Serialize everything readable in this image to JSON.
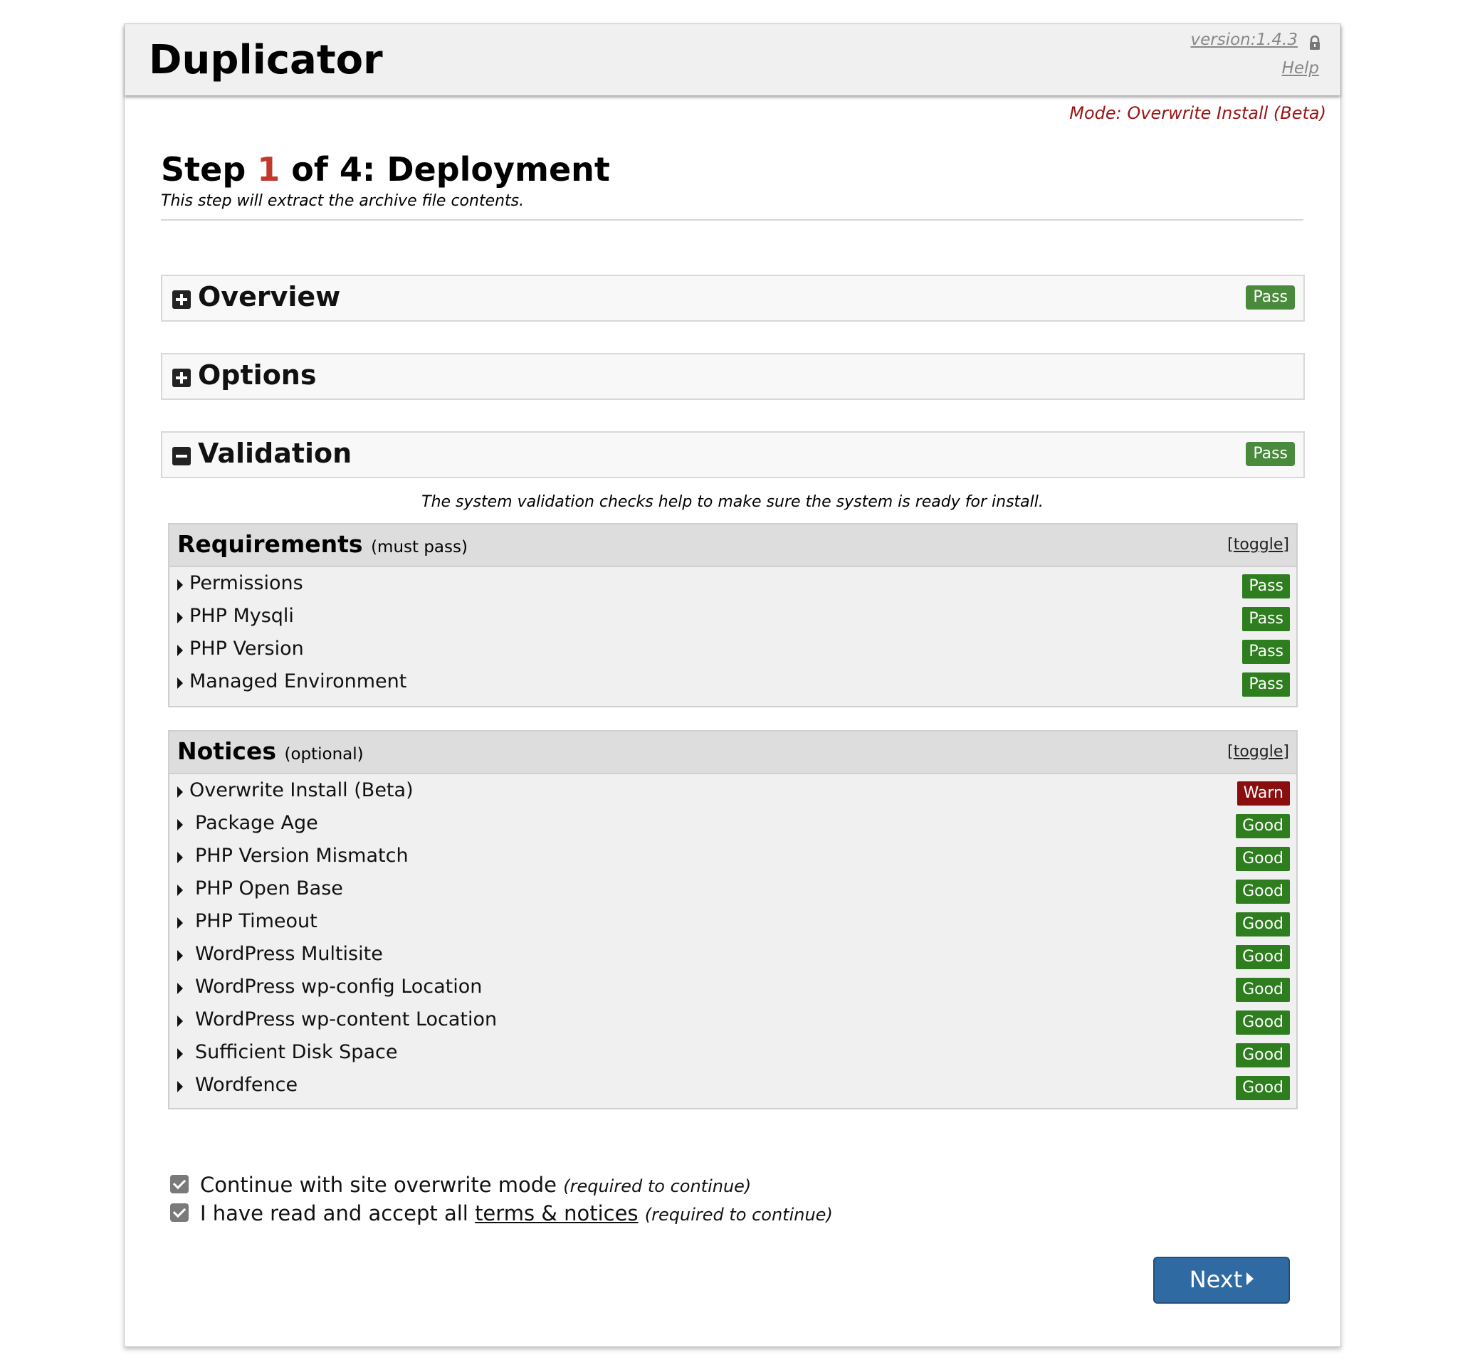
{
  "app": {
    "logo": "Duplicator",
    "version": "version:1.4.3",
    "help": "Help",
    "mode": "Mode: Overwrite Install (Beta)"
  },
  "step": {
    "prefix": "Step ",
    "number": "1",
    "suffix": " of 4: Deployment",
    "subtitle": "This step will extract the archive file contents."
  },
  "sections": [
    {
      "title": "Overview",
      "badge": "Pass",
      "state": "collapsed"
    },
    {
      "title": "Options",
      "badge": "",
      "state": "collapsed"
    },
    {
      "title": "Validation",
      "badge": "Pass",
      "state": "expanded"
    }
  ],
  "validation": {
    "note": "The system validation checks help to make sure the system is ready for install.",
    "requirements": {
      "title": "Requirements",
      "subtitle": "(must pass)",
      "toggle": "toggle",
      "items": [
        {
          "label": "Permissions",
          "status": "Pass"
        },
        {
          "label": "PHP Mysqli",
          "status": "Pass"
        },
        {
          "label": "PHP Version",
          "status": "Pass"
        },
        {
          "label": "Managed Environment",
          "status": "Pass"
        }
      ]
    },
    "notices": {
      "title": "Notices",
      "subtitle": "(optional)",
      "toggle": "toggle",
      "items": [
        {
          "label": "Overwrite Install (Beta)",
          "status": "Warn"
        },
        {
          "label": "Package Age",
          "status": "Good"
        },
        {
          "label": "PHP Version Mismatch",
          "status": "Good"
        },
        {
          "label": "PHP Open Base",
          "status": "Good"
        },
        {
          "label": "PHP Timeout",
          "status": "Good"
        },
        {
          "label": "WordPress Multisite",
          "status": "Good"
        },
        {
          "label": "WordPress wp-config Location",
          "status": "Good"
        },
        {
          "label": "WordPress wp-content Location",
          "status": "Good"
        },
        {
          "label": "Sufficient Disk Space",
          "status": "Good"
        },
        {
          "label": "Wordfence",
          "status": "Good"
        }
      ]
    }
  },
  "confirm": {
    "overwrite_text": "Continue with site overwrite mode",
    "overwrite_req": "(required to continue)",
    "overwrite_checked": true,
    "terms_text": "I have read and accept all",
    "terms_link": "terms & notices",
    "terms_req": "(required to continue)",
    "terms_checked": true
  },
  "next_label": "Next",
  "colors": {
    "pass_section": "#4a8a3c",
    "pass_item": "#2e7d1e",
    "warn": "#8b0e0e",
    "mode_text": "#9b1313",
    "step_number": "#c0392b",
    "next_button": "#2f6aa3"
  }
}
